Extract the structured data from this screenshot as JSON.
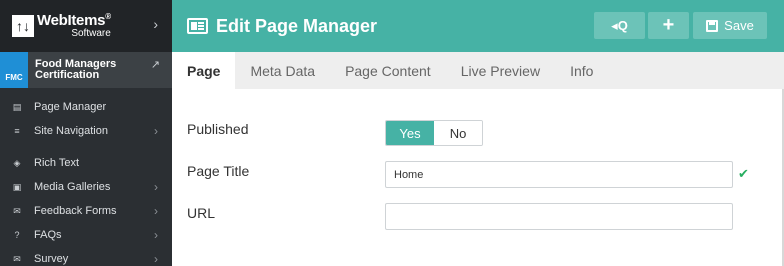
{
  "brand": {
    "mark": "↑↓",
    "name": "WebItems",
    "reg": "®",
    "sub": "Software"
  },
  "site": {
    "badge": "FMC",
    "name": "Food Managers Certification"
  },
  "sidebar": {
    "items": [
      {
        "label": "Page Manager",
        "icon": "page-manager-icon",
        "has_children": false
      },
      {
        "label": "Site Navigation",
        "icon": "list-icon",
        "has_children": true
      },
      {
        "label": "Rich Text",
        "icon": "cube-icon",
        "has_children": false
      },
      {
        "label": "Media Galleries",
        "icon": "image-icon",
        "has_children": true
      },
      {
        "label": "Feedback Forms",
        "icon": "envelope-icon",
        "has_children": true
      },
      {
        "label": "FAQs",
        "icon": "question-icon",
        "has_children": true
      },
      {
        "label": "Survey",
        "icon": "envelope-icon",
        "has_children": true
      }
    ]
  },
  "header": {
    "title": "Edit Page Manager",
    "search_label": "◂Q",
    "add_label": "+",
    "save_label": "Save"
  },
  "tabs": [
    {
      "label": "Page",
      "active": true
    },
    {
      "label": "Meta Data",
      "active": false
    },
    {
      "label": "Page Content",
      "active": false
    },
    {
      "label": "Live Preview",
      "active": false
    },
    {
      "label": "Info",
      "active": false
    }
  ],
  "form": {
    "published_label": "Published",
    "yes_label": "Yes",
    "no_label": "No",
    "published_value": "Yes",
    "page_title_label": "Page Title",
    "page_title_value": "Home",
    "url_label": "URL",
    "url_value": ""
  },
  "colors": {
    "accent": "#46b2a5",
    "sidebar": "#2b2f33",
    "valid": "#27ae60"
  }
}
